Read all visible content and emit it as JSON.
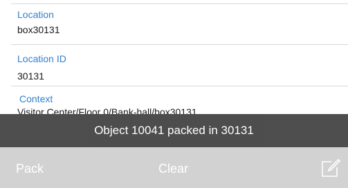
{
  "fields": {
    "location": {
      "label": "Location",
      "value": "box30131"
    },
    "location_id": {
      "label": "Location ID",
      "value": "30131"
    },
    "context": {
      "label": "Context",
      "value": "Visitor Center/Floor 0/Bank-hall/box30131"
    }
  },
  "toast": {
    "message": "Object 10041 packed in 30131"
  },
  "toolbar": {
    "pack_label": "Pack",
    "clear_label": "Clear",
    "compose_icon": "compose-icon"
  },
  "colors": {
    "label_blue": "#2f7fd1",
    "toast_bg": "#4a4a4a",
    "toolbar_bg": "#d2d2d2"
  }
}
